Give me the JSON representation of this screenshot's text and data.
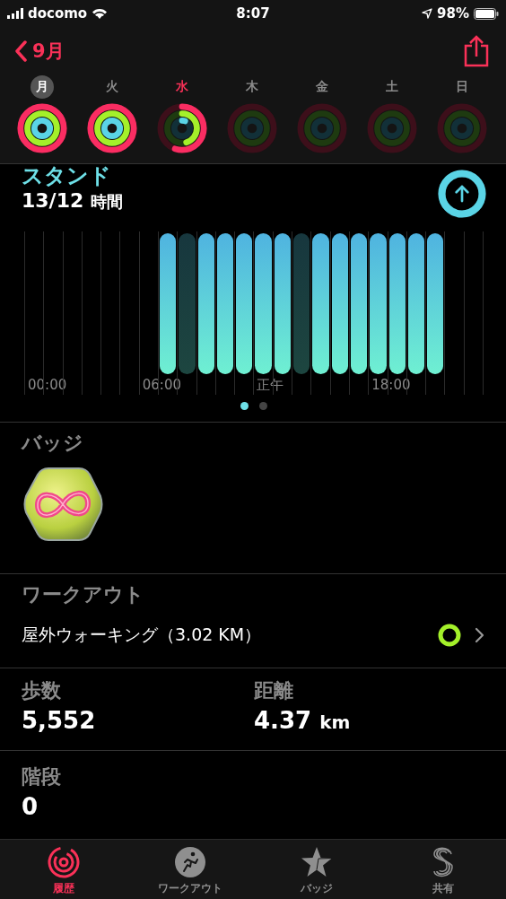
{
  "status_bar": {
    "carrier": "docomo",
    "time": "8:07",
    "battery": "98%"
  },
  "nav": {
    "back_label": "9月"
  },
  "days": [
    {
      "label": "月",
      "selected": true,
      "today": false,
      "kind": "closed"
    },
    {
      "label": "火",
      "selected": false,
      "today": false,
      "kind": "closed"
    },
    {
      "label": "水",
      "selected": false,
      "today": true,
      "kind": "partial"
    },
    {
      "label": "木",
      "selected": false,
      "today": false,
      "kind": "empty"
    },
    {
      "label": "金",
      "selected": false,
      "today": false,
      "kind": "empty"
    },
    {
      "label": "土",
      "selected": false,
      "today": false,
      "kind": "empty"
    },
    {
      "label": "日",
      "selected": false,
      "today": false,
      "kind": "empty"
    }
  ],
  "stand": {
    "title": "スタンド",
    "value": "13/12",
    "unit": "時間",
    "hours": [
      {
        "kind": "empty",
        "axis_label": "00:00"
      },
      {
        "kind": "empty"
      },
      {
        "kind": "empty"
      },
      {
        "kind": "empty"
      },
      {
        "kind": "empty"
      },
      {
        "kind": "empty"
      },
      {
        "kind": "empty",
        "axis_label": "06:00"
      },
      {
        "kind": "stood"
      },
      {
        "kind": "missed"
      },
      {
        "kind": "stood"
      },
      {
        "kind": "stood"
      },
      {
        "kind": "stood"
      },
      {
        "kind": "stood",
        "axis_label": "正午"
      },
      {
        "kind": "stood"
      },
      {
        "kind": "missed"
      },
      {
        "kind": "stood"
      },
      {
        "kind": "stood"
      },
      {
        "kind": "stood"
      },
      {
        "kind": "stood",
        "axis_label": "18:00"
      },
      {
        "kind": "stood"
      },
      {
        "kind": "stood"
      },
      {
        "kind": "stood"
      },
      {
        "kind": "empty"
      },
      {
        "kind": "empty"
      }
    ],
    "pages": [
      {
        "selected": true
      },
      {
        "selected": false
      }
    ]
  },
  "badges": {
    "title": "バッジ"
  },
  "workouts": {
    "title": "ワークアウト",
    "items": [
      {
        "name": "屋外ウォーキング（3.02 KM）"
      }
    ]
  },
  "stats": [
    {
      "label": "歩数",
      "value": "5,552"
    },
    {
      "label": "距離",
      "value": "4.37",
      "unit": "km"
    }
  ],
  "stairs": {
    "label": "階段",
    "value": "0"
  },
  "tabs": [
    {
      "label": "履歴",
      "kind": "history",
      "selected": true
    },
    {
      "label": "ワークアウト",
      "kind": "workout",
      "selected": false
    },
    {
      "label": "バッジ",
      "kind": "badges",
      "selected": false
    },
    {
      "label": "共有",
      "kind": "sharing",
      "selected": false
    }
  ]
}
